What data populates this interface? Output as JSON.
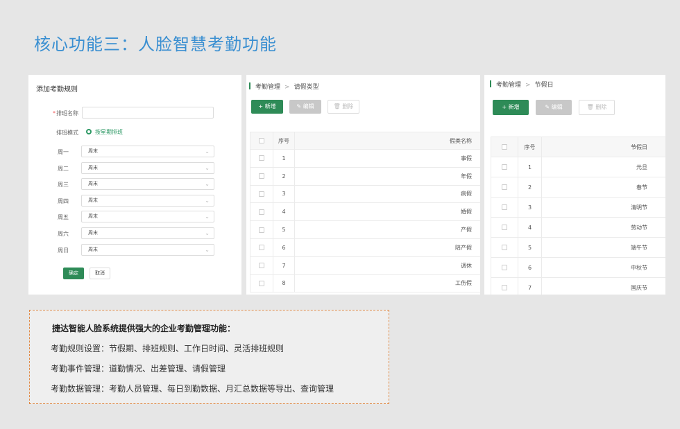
{
  "title": "核心功能三：人脸智慧考勤功能",
  "rule_form": {
    "title": "添加考勤规则",
    "name_label": "排班名称",
    "required_mark": "*",
    "name_value": "",
    "mode_label": "排班模式",
    "mode_option": "按星期排班",
    "days": [
      {
        "label": "周一",
        "value": "周末"
      },
      {
        "label": "周二",
        "value": "周末"
      },
      {
        "label": "周三",
        "value": "周末"
      },
      {
        "label": "周四",
        "value": "周末"
      },
      {
        "label": "周五",
        "value": "周末"
      },
      {
        "label": "周六",
        "value": "周末"
      },
      {
        "label": "周日",
        "value": "周末"
      }
    ],
    "ok_label": "确定",
    "cancel_label": "取消"
  },
  "leave_panel": {
    "breadcrumb": [
      "考勤管理",
      "请假类型"
    ],
    "add_label": "+ 新增",
    "edit_label": "✎ 编辑",
    "delete_label": "🗑 删除",
    "columns": [
      "序号",
      "假类名称"
    ],
    "rows": [
      {
        "no": "1",
        "name": "事假"
      },
      {
        "no": "2",
        "name": "年假"
      },
      {
        "no": "3",
        "name": "病假"
      },
      {
        "no": "4",
        "name": "婚假"
      },
      {
        "no": "5",
        "name": "产假"
      },
      {
        "no": "6",
        "name": "陪产假"
      },
      {
        "no": "7",
        "name": "调休"
      },
      {
        "no": "8",
        "name": "工伤假"
      }
    ]
  },
  "holiday_panel": {
    "breadcrumb": [
      "考勤管理",
      "节假日"
    ],
    "add_label": "+ 新增",
    "edit_label": "✎ 编辑",
    "delete_label": "🗑 删除",
    "columns": [
      "序号",
      "节假日"
    ],
    "rows": [
      {
        "no": "1",
        "name": "元旦"
      },
      {
        "no": "2",
        "name": "春节"
      },
      {
        "no": "3",
        "name": "清明节"
      },
      {
        "no": "4",
        "name": "劳动节"
      },
      {
        "no": "5",
        "name": "端午节"
      },
      {
        "no": "6",
        "name": "中秋节"
      },
      {
        "no": "7",
        "name": "国庆节"
      }
    ]
  },
  "info": {
    "heading": "捷达智能人脸系统提供强大的企业考勤管理功能：",
    "lines": [
      "考勤规则设置：节假期、排班规则、工作日时间、灵活排班规则",
      "考勤事件管理：道勤情况、出差管理、请假管理",
      "考勤数据管理：考勤人员管理、每日到勤数据、月汇总数据等导出、查询管理"
    ]
  },
  "colors": {
    "accent_green": "#2e8b57",
    "title_blue": "#3a8fd1",
    "dashed_border": "#e08a46"
  }
}
